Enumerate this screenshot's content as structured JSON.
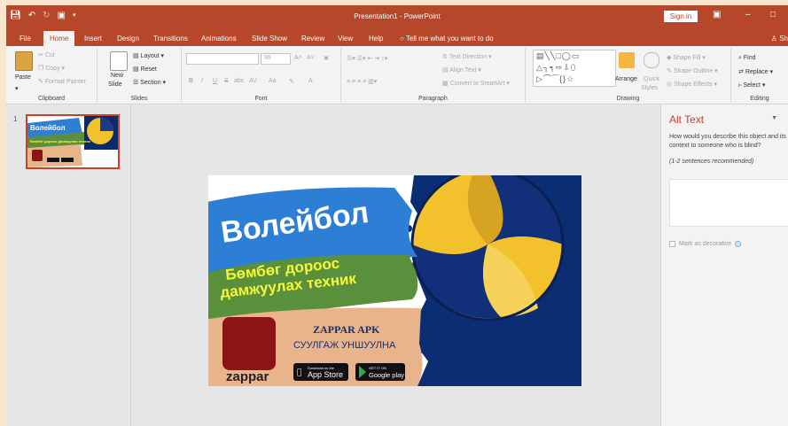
{
  "titlebar": {
    "document_title": "Presentation1 - PowerPoint",
    "signin_label": "Sign in"
  },
  "tabs": [
    "File",
    "Home",
    "Insert",
    "Design",
    "Transitions",
    "Animations",
    "Slide Show",
    "Review",
    "View",
    "Help"
  ],
  "active_tab": "Home",
  "tell_me": "Tell me what you want to do",
  "share": "Sh",
  "ribbon": {
    "clipboard": {
      "label": "Clipboard",
      "paste": "Paste",
      "cut": "Cut",
      "copy": "Copy",
      "format_painter": "Format Painter"
    },
    "slides": {
      "label": "Slides",
      "new_slide_1": "New",
      "new_slide_2": "Slide",
      "layout": "Layout",
      "reset": "Reset",
      "section": "Section"
    },
    "font": {
      "label": "Font",
      "bold": "B",
      "italic": "I",
      "underline": "U",
      "strike": "S",
      "shadow": "abc",
      "spacing": "AV",
      "case": "Aa",
      "color": "A",
      "size": "96",
      "grow": "A˄",
      "shrink": "A˅"
    },
    "paragraph": {
      "label": "Paragraph",
      "text_direction": "Text Direction",
      "align_text": "Align Text",
      "smartart": "Convert to SmartArt"
    },
    "drawing": {
      "label": "Drawing",
      "arrange": "Arrange",
      "quick_styles_1": "Quick",
      "quick_styles_2": "Styles",
      "shape_fill": "Shape Fill",
      "shape_outline": "Shape Outline",
      "shape_effects": "Shape Effects",
      "shapes_row1": "▤╲╲□◯▭",
      "shapes_row2": "△┐┑⇨⇩⬯",
      "shapes_row3": "▷⌒⁀{}☆"
    },
    "editing": {
      "label": "Editing",
      "find": "Find",
      "replace": "Replace",
      "select": "Select"
    }
  },
  "thumbnail": {
    "slide_number": "1",
    "title": "Волейбол",
    "sub": "Бөмбөг дороос дамжуулах техник"
  },
  "slide": {
    "title": "Волейбол",
    "subtitle_line1": "Бөмбөг дороос",
    "subtitle_line2": "дамжуулах техник",
    "zappar_app": "ZAPPAR APK",
    "zappar_install": "СУУЛГАЖ УНШУУЛНА",
    "zappar_logo": "zappar",
    "appstore_small": "Download on the",
    "appstore_big": "App Store",
    "googleplay_small": "GET IT ON",
    "googleplay_big": "Google play"
  },
  "alt_text": {
    "title": "Alt Text",
    "description": "How would you describe this object and its context to someone who is blind?",
    "hint": "(1-2 sentences recommended)",
    "decorative_label": "Mark as decorative",
    "info": "i"
  },
  "colors": {
    "accent": "#b7472a",
    "active_tab_text": "#b7472a",
    "alt_title": "#c5432a"
  }
}
